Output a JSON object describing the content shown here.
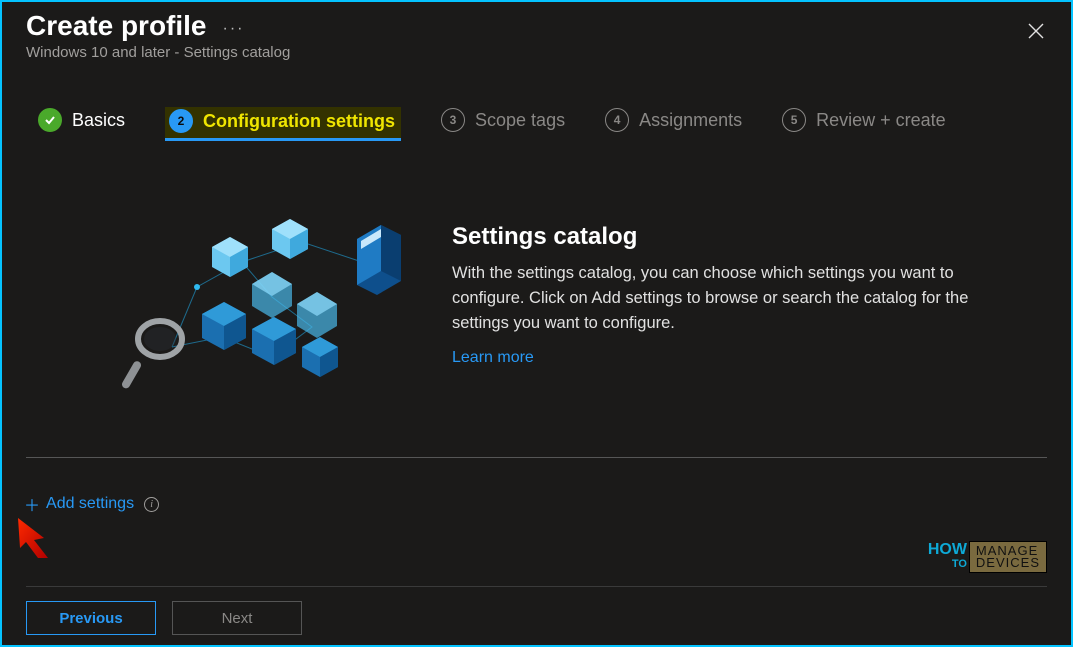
{
  "header": {
    "title": "Create profile",
    "subtitle": "Windows 10 and later - Settings catalog",
    "more_label": "···"
  },
  "steps": [
    {
      "number": "✓",
      "label": "Basics",
      "state": "completed"
    },
    {
      "number": "2",
      "label": "Configuration settings",
      "state": "active"
    },
    {
      "number": "3",
      "label": "Scope tags",
      "state": "pending"
    },
    {
      "number": "4",
      "label": "Assignments",
      "state": "pending"
    },
    {
      "number": "5",
      "label": "Review + create",
      "state": "pending"
    }
  ],
  "catalog": {
    "heading": "Settings catalog",
    "description": "With the settings catalog, you can choose which settings you want to configure. Click on Add settings to browse or search the catalog for the settings you want to configure.",
    "learn_more": "Learn more"
  },
  "actions": {
    "add_settings": "Add settings",
    "previous": "Previous",
    "next": "Next"
  },
  "watermark": {
    "how": "HOW",
    "to": "TO",
    "manage": "MANAGE",
    "devices": "DEVICES"
  }
}
